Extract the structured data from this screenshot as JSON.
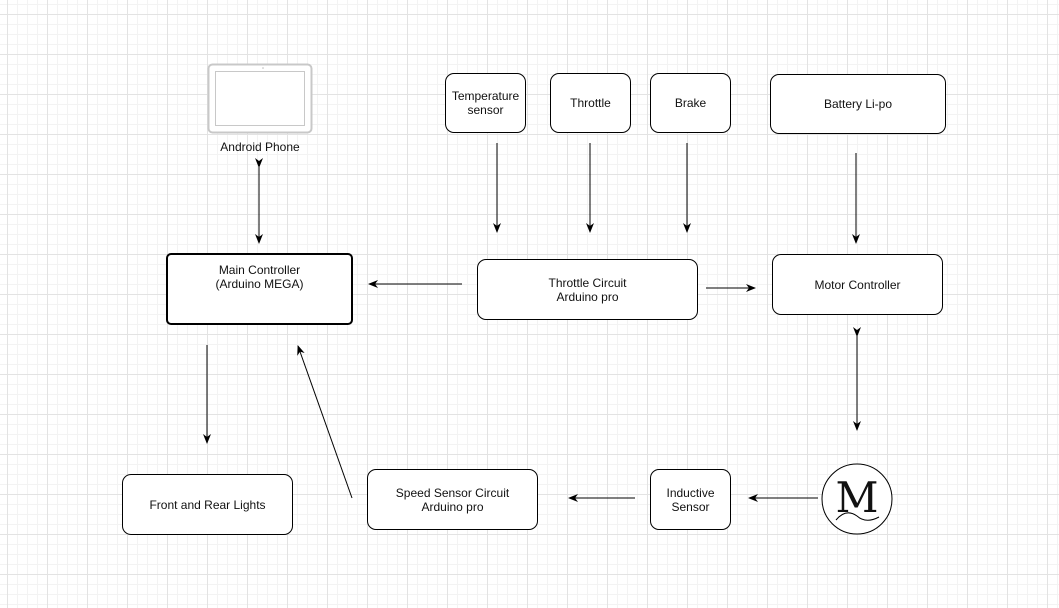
{
  "nodes": {
    "android": "Android Phone",
    "temperature": "Temperature\nsensor",
    "throttle": "Throttle",
    "brake": "Brake",
    "battery": "Battery Li-po",
    "main": "Main Controller\n(Arduino MEGA)",
    "throttle_circuit": "Throttle Circuit\nArduino pro",
    "motor_controller": "Motor Controller",
    "lights": "Front and Rear Lights",
    "speed_sensor": "Speed Sensor Circuit\nArduino pro",
    "inductive": "Inductive\nSensor",
    "motor": "M"
  }
}
